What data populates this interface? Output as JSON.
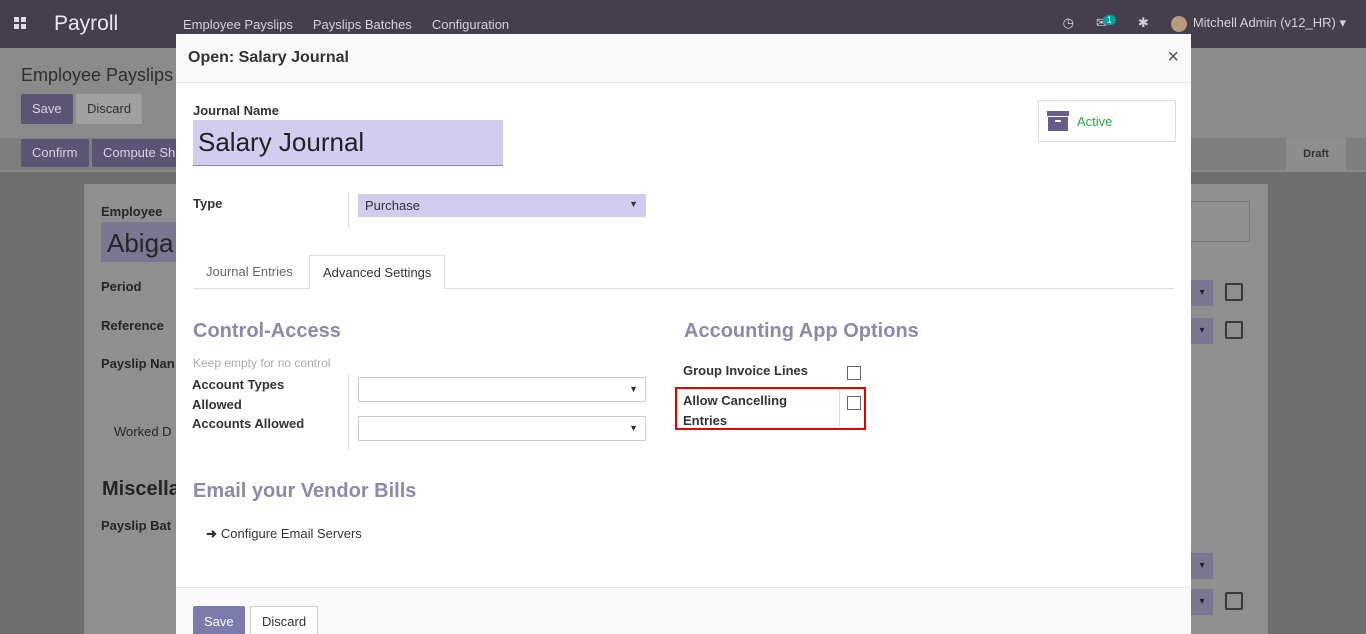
{
  "app": {
    "name": "Payroll",
    "menu": [
      "Employee Payslips",
      "Payslips Batches",
      "Configuration"
    ],
    "systray": {
      "chat_count": "1",
      "user": "Mitchell Admin (v12_HR)"
    }
  },
  "background": {
    "breadcrumb": "Employee Payslips",
    "save_label": "Save",
    "discard_label": "Discard",
    "confirm_label": "Confirm",
    "compute_label": "Compute Sh",
    "status": "Draft",
    "employee_label": "Employee",
    "employee_value": "Abiga",
    "period_label": "Period",
    "reference_label": "Reference",
    "payslip_name_label": "Payslip Nan",
    "worked_tab": "Worked D",
    "misc_title": "Miscella",
    "payslip_batch_label": "Payslip Bat"
  },
  "modal": {
    "title": "Open: Salary Journal",
    "close": "×",
    "journal_name_label": "Journal Name",
    "journal_name_value": "Salary Journal",
    "active_label": "Active",
    "type_label": "Type",
    "type_value": "Purchase",
    "tabs": [
      "Journal Entries",
      "Advanced Settings"
    ],
    "active_tab": "Advanced Settings",
    "control_access": {
      "title": "Control-Access",
      "hint": "Keep empty for no control",
      "account_types_label_1": "Account Types",
      "account_types_label_2": "Allowed",
      "accounts_allowed_label": "Accounts Allowed"
    },
    "accounting_options": {
      "title": "Accounting App Options",
      "group_invoice_label": "Group Invoice Lines",
      "group_invoice_checked": false,
      "allow_cancel_label_1": "Allow Cancelling",
      "allow_cancel_label_2": "Entries",
      "allow_cancel_checked": false
    },
    "vendor_bills": {
      "title": "Email your Vendor Bills",
      "link": "Configure Email Servers"
    },
    "footer": {
      "save_label": "Save",
      "discard_label": "Discard"
    }
  },
  "colors": {
    "accent": "#7c7bad",
    "required_field": "#d2cdef",
    "active": "#28a745",
    "highlight": "#e00000"
  }
}
